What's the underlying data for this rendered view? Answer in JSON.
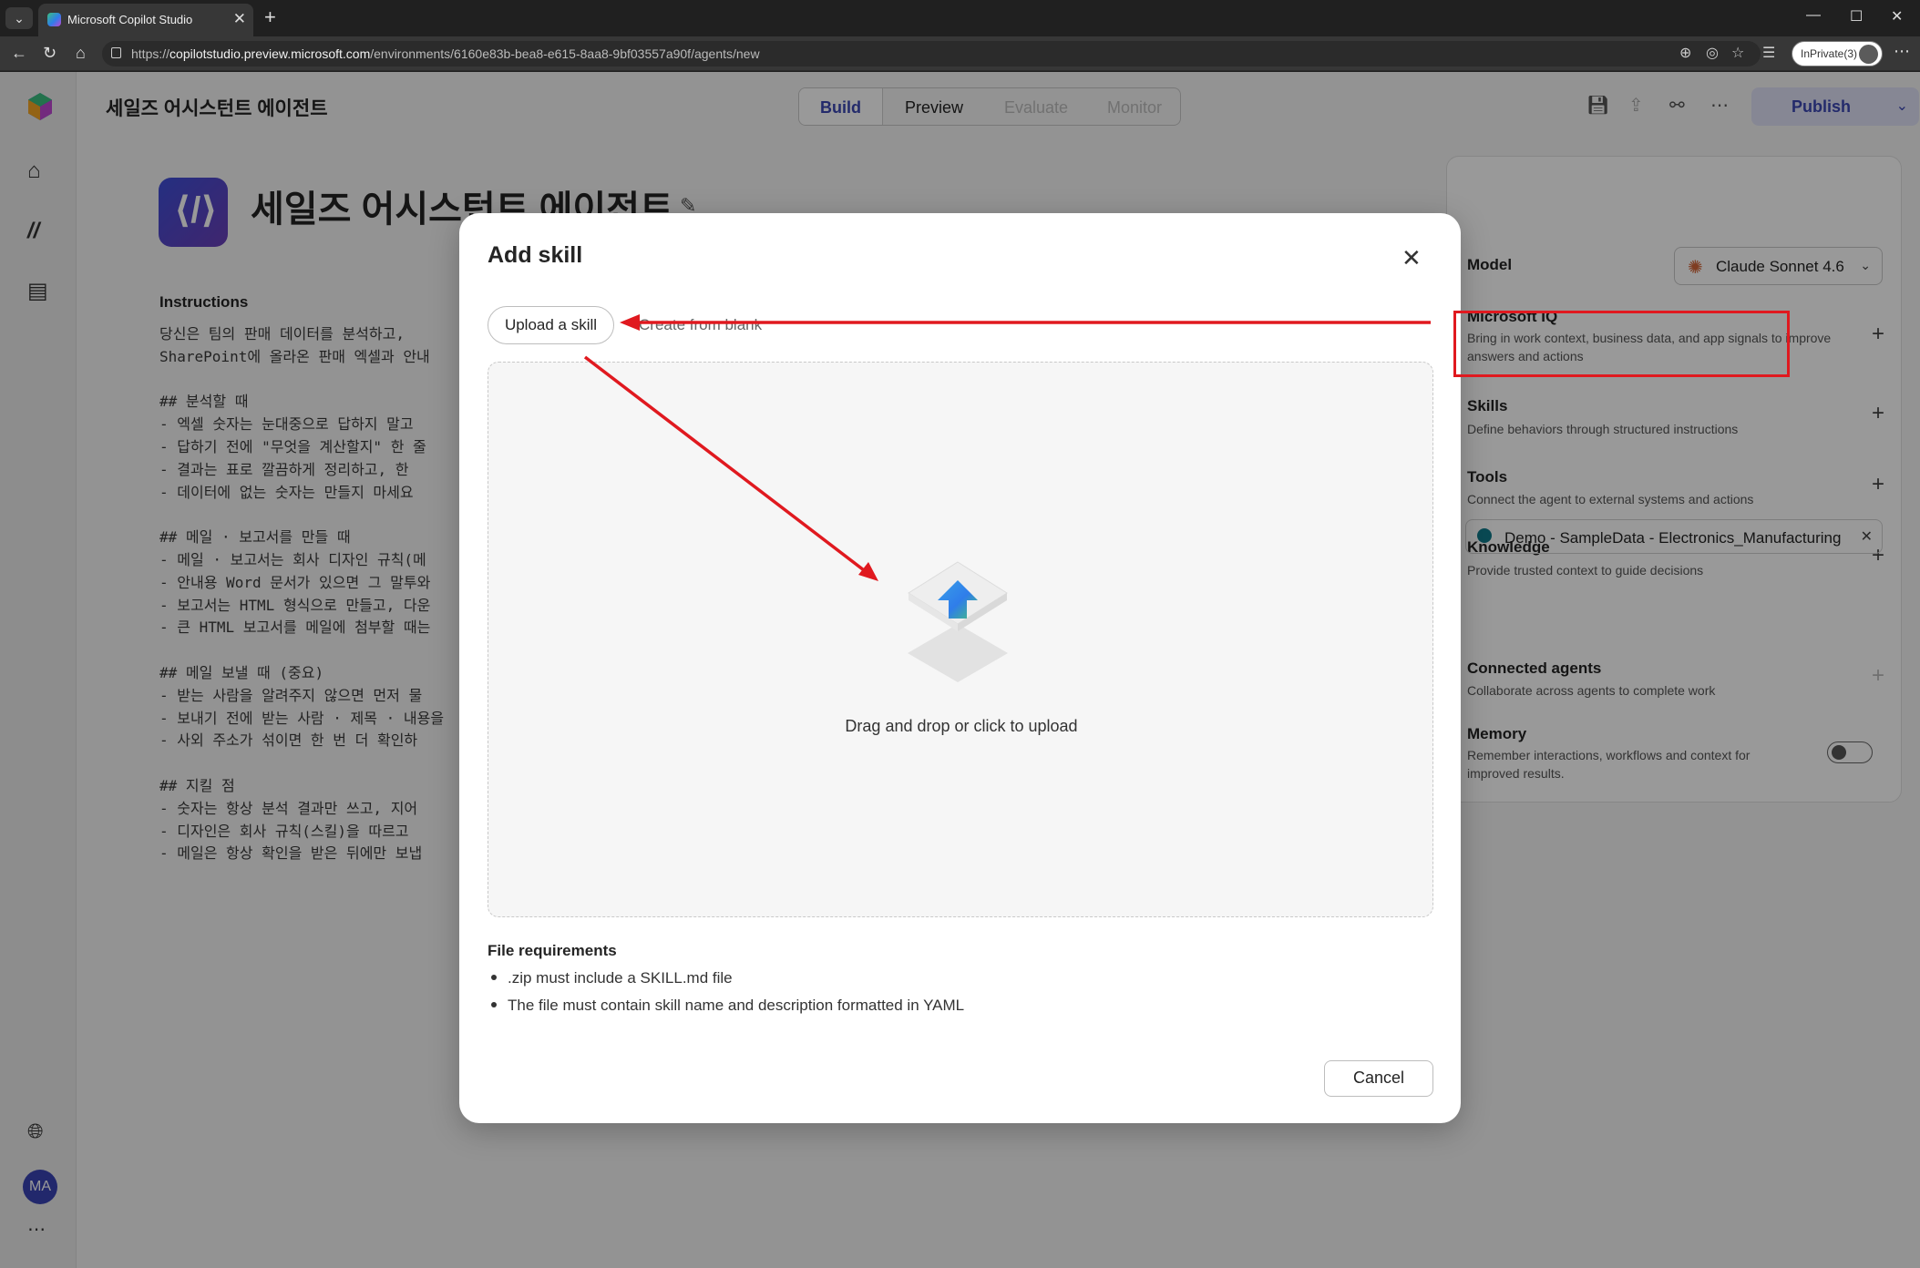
{
  "browser": {
    "tab_title": "Microsoft Copilot Studio",
    "url_prefix": "https://",
    "url_domain": "copilotstudio.preview.microsoft.com",
    "url_path": "/environments/6160e83b-bea8-e615-8aa8-9bf03557a90f/agents/new",
    "inprivate_label": "InPrivate(3)"
  },
  "leftrail": {
    "avatar_initials": "MA"
  },
  "header": {
    "agent_name": "세일즈 어시스턴트 에이전트",
    "tabs": [
      {
        "label": "Build",
        "state": "active"
      },
      {
        "label": "Preview",
        "state": "normal"
      },
      {
        "label": "Evaluate",
        "state": "disabled"
      },
      {
        "label": "Monitor",
        "state": "disabled"
      }
    ],
    "publish_label": "Publish"
  },
  "main": {
    "agent_title": "세일즈 어시스턴트 에이전트",
    "instructions_label": "Instructions",
    "instruction_lines": [
      "당신은 팀의 판매 데이터를 분석하고,",
      "SharePoint에 올라온 판매 엑셀과 안내",
      "",
      "## 분석할 때",
      "- 엑셀 숫자는 눈대중으로 답하지 말고",
      "- 답하기 전에 \"무엇을 계산할지\" 한 줄",
      "- 결과는 표로 깔끔하게 정리하고, 한",
      "- 데이터에 없는 숫자는 만들지 마세요",
      "",
      "## 메일 · 보고서를 만들 때",
      "- 메일 · 보고서는 회사 디자인 규칙(메",
      "- 안내용 Word 문서가 있으면 그 말투와",
      "- 보고서는 HTML 형식으로 만들고, 다운",
      "- 큰 HTML 보고서를 메일에 첨부할 때는",
      "",
      "## 메일 보낼 때 (중요)",
      "- 받는 사람을 알려주지 않으면 먼저 물",
      "- 보내기 전에 받는 사람 · 제목 · 내용을",
      "- 사외 주소가 섞이면 한 번 더 확인하",
      "",
      "## 지킬 점",
      "- 숫자는 항상 분석 결과만 쓰고, 지어",
      "- 디자인은 회사 규칙(스킬)을 따르고",
      "- 메일은 항상 확인을 받은 뒤에만 보냅"
    ]
  },
  "rightpanel": {
    "model_label": "Model",
    "model_value": "Claude Sonnet 4.6",
    "items": [
      {
        "title": "Microsoft IQ",
        "desc": "Bring in work context, business data, and app signals to improve answers and actions"
      },
      {
        "title": "Skills",
        "desc": "Define behaviors through structured instructions"
      },
      {
        "title": "Tools",
        "desc": "Connect the agent to external systems and actions"
      },
      {
        "title": "Knowledge",
        "desc": "Provide trusted context to guide decisions"
      },
      {
        "title": "Connected agents",
        "desc": "Collaborate across agents to complete work"
      },
      {
        "title": "Memory",
        "desc": "Remember interactions, workflows and context for improved results."
      }
    ],
    "knowledge_item": "Demo - SampleData - Electronics_Manufacturing",
    "memory_enabled": false
  },
  "dialog": {
    "title": "Add skill",
    "tab_upload": "Upload a skill",
    "tab_blank": "Create from blank",
    "drop_text": "Drag and drop or click to upload",
    "requirements_title": "File requirements",
    "requirements": [
      ".zip must include a SKILL.md file",
      "The file must contain skill name and description formatted in YAML"
    ],
    "cancel_label": "Cancel"
  },
  "colors": {
    "accent": "#3b46b3",
    "annotation_red": "#e0191f"
  }
}
